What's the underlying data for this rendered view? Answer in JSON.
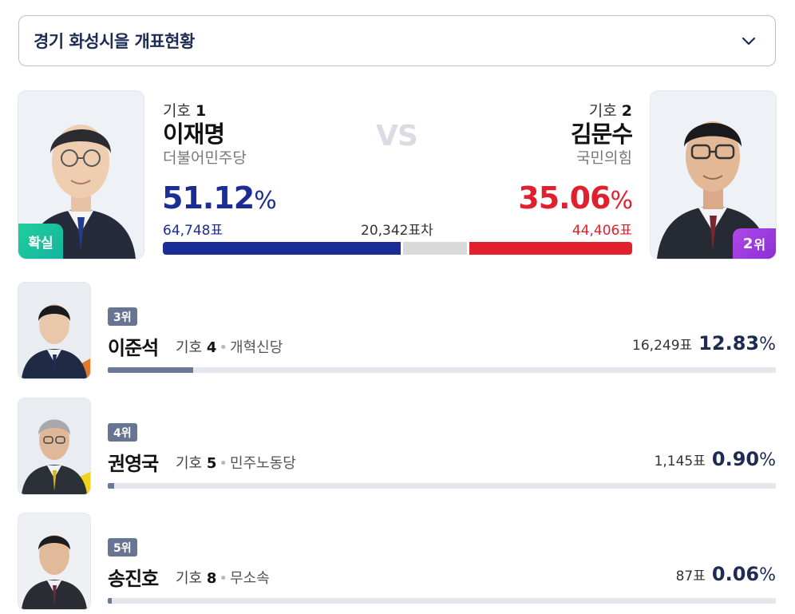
{
  "region": {
    "label": "경기 화성시을 개표현황",
    "icon": "chevron-down-icon"
  },
  "head_to_head": {
    "vs_label": "VS",
    "diff_votes": "20,342",
    "diff_unit": "표차",
    "left": {
      "giho_label": "기호",
      "giho_num": "1",
      "name": "이재명",
      "party": "더불어민주당",
      "pct": "51.12",
      "pct_unit": "%",
      "votes": "64,748",
      "votes_unit": "표",
      "status_badge": "확실",
      "color": "#1b2d94",
      "share": 51.12
    },
    "right": {
      "giho_label": "기호",
      "giho_num": "2",
      "name": "김문수",
      "party": "국민의힘",
      "pct": "35.06",
      "pct_unit": "%",
      "votes": "44,406",
      "votes_unit": "표",
      "rank_badge_num": "2",
      "rank_badge_unit": "위",
      "color": "#e3202e",
      "share": 35.06
    }
  },
  "others": [
    {
      "rank": "3위",
      "name": "이준석",
      "giho_label": "기호",
      "giho_num": "4",
      "party": "개혁신당",
      "votes": "16,249",
      "votes_unit": "표",
      "pct": "12.83",
      "pct_unit": "%",
      "share": 12.83
    },
    {
      "rank": "4위",
      "name": "권영국",
      "giho_label": "기호",
      "giho_num": "5",
      "party": "민주노동당",
      "votes": "1,145",
      "votes_unit": "표",
      "pct": "0.90",
      "pct_unit": "%",
      "share": 0.9
    },
    {
      "rank": "5위",
      "name": "송진호",
      "giho_label": "기호",
      "giho_num": "8",
      "party": "무소속",
      "votes": "87",
      "votes_unit": "표",
      "pct": "0.06",
      "pct_unit": "%",
      "share": 0.06
    }
  ],
  "colors": {
    "accent_navy": "#1e2b52",
    "confirm_green": "#1fcf9c",
    "rank_purple": "#b049e8",
    "minor_bar": "#6a7796"
  }
}
